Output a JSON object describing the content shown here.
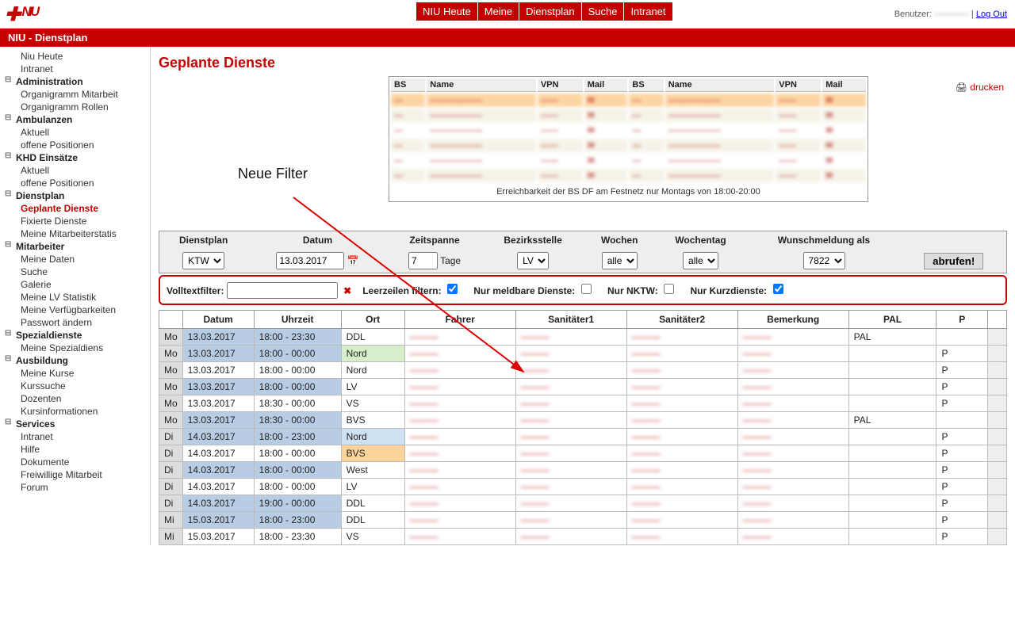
{
  "top": {
    "user_label": "Benutzer:",
    "user_name": "————",
    "logout": "Log Out",
    "nav": [
      "NIU Heute",
      "Meine",
      "Dienstplan",
      "Suche",
      "Intranet"
    ],
    "redbar": "NIU - Dienstplan"
  },
  "sidebar": [
    {
      "type": "leaf",
      "label": "Niu Heute"
    },
    {
      "type": "leaf",
      "label": "Intranet"
    },
    {
      "type": "head",
      "label": "Administration"
    },
    {
      "type": "leaf",
      "label": "Organigramm Mitarbeit"
    },
    {
      "type": "leaf",
      "label": "Organigramm Rollen"
    },
    {
      "type": "head",
      "label": "Ambulanzen"
    },
    {
      "type": "leaf",
      "label": "Aktuell"
    },
    {
      "type": "leaf",
      "label": "offene Positionen"
    },
    {
      "type": "head",
      "label": "KHD Einsätze"
    },
    {
      "type": "leaf",
      "label": "Aktuell"
    },
    {
      "type": "leaf",
      "label": "offene Positionen"
    },
    {
      "type": "head",
      "label": "Dienstplan"
    },
    {
      "type": "leaf",
      "label": "Geplante Dienste",
      "active": true
    },
    {
      "type": "leaf",
      "label": "Fixierte Dienste"
    },
    {
      "type": "leaf",
      "label": "Meine Mitarbeiterstatis"
    },
    {
      "type": "head",
      "label": "Mitarbeiter"
    },
    {
      "type": "leaf",
      "label": "Meine Daten"
    },
    {
      "type": "leaf",
      "label": "Suche"
    },
    {
      "type": "leaf",
      "label": "Galerie"
    },
    {
      "type": "leaf",
      "label": "Meine LV Statistik"
    },
    {
      "type": "leaf",
      "label": "Meine Verfügbarkeiten"
    },
    {
      "type": "leaf",
      "label": "Passwort ändern"
    },
    {
      "type": "head",
      "label": "Spezialdienste"
    },
    {
      "type": "leaf",
      "label": "Meine Spezialdiens"
    },
    {
      "type": "head",
      "label": "Ausbildung"
    },
    {
      "type": "leaf",
      "label": "Meine Kurse"
    },
    {
      "type": "leaf",
      "label": "Kurssuche"
    },
    {
      "type": "leaf",
      "label": "Dozenten"
    },
    {
      "type": "leaf",
      "label": "Kursinformationen"
    },
    {
      "type": "head",
      "label": "Services"
    },
    {
      "type": "leaf",
      "label": "Intranet"
    },
    {
      "type": "leaf",
      "label": "Hilfe"
    },
    {
      "type": "leaf",
      "label": "Dokumente"
    },
    {
      "type": "leaf",
      "label": "Freiwillige Mitarbeit"
    },
    {
      "type": "leaf",
      "label": "Forum"
    }
  ],
  "page": {
    "title": "Geplante Dienste",
    "print": "drucken",
    "annotation": "Neue Filter"
  },
  "topinfo": {
    "headers": [
      "BS",
      "Name",
      "VPN",
      "Mail",
      "BS",
      "Name",
      "VPN",
      "Mail"
    ],
    "footnote": "Erreichbarkeit der BS DF am Festnetz nur Montags von 18:00-20:00"
  },
  "controls": {
    "headers": [
      "Dienstplan",
      "Datum",
      "Zeitspanne",
      "Bezirksstelle",
      "Wochen",
      "Wochentag",
      "Wunschmeldung als",
      ""
    ],
    "dienstplan": "KTW",
    "datum": "13.03.2017",
    "zeitspanne": "7",
    "zeitspanne_unit": "Tage",
    "bezirksstelle": "LV",
    "wochen": "alle",
    "wochentag": "alle",
    "wunsch": "7822",
    "button": "abrufen!"
  },
  "filters": {
    "volltext_label": "Volltextfilter:",
    "volltext_value": "",
    "leer_label": "Leerzeilen filtern:",
    "leer_checked": true,
    "meld_label": "Nur meldbare Dienste:",
    "meld_checked": false,
    "nktw_label": "Nur NKTW:",
    "nktw_checked": false,
    "kurz_label": "Nur Kurzdienste:",
    "kurz_checked": true
  },
  "grid": {
    "headers": [
      "",
      "Datum",
      "Uhrzeit",
      "Ort",
      "Fahrer",
      "Sanitäter1",
      "Sanitäter2",
      "Bemerkung",
      "PAL",
      "P",
      ""
    ],
    "rows": [
      {
        "day": "Mo",
        "date": "13.03.2017",
        "time": "18:00 - 23:30",
        "ort": "DDL",
        "cls": "blue",
        "pal": "PAL",
        "p": ""
      },
      {
        "day": "Mo",
        "date": "13.03.2017",
        "time": "18:00 - 00:00",
        "ort": "Nord",
        "cls": "blue gr",
        "pal": "",
        "p": "P"
      },
      {
        "day": "Mo",
        "date": "13.03.2017",
        "time": "18:00 - 00:00",
        "ort": "Nord",
        "cls": "",
        "pal": "",
        "p": "P"
      },
      {
        "day": "Mo",
        "date": "13.03.2017",
        "time": "18:00 - 00:00",
        "ort": "LV",
        "cls": "blue",
        "pal": "",
        "p": "P"
      },
      {
        "day": "Mo",
        "date": "13.03.2017",
        "time": "18:30 - 00:00",
        "ort": "VS",
        "cls": "",
        "pal": "",
        "p": "P"
      },
      {
        "day": "Mo",
        "date": "13.03.2017",
        "time": "18:30 - 00:00",
        "ort": "BVS",
        "cls": "blue",
        "pal": "PAL",
        "p": ""
      },
      {
        "day": "Di",
        "date": "14.03.2017",
        "time": "18:00 - 23:00",
        "ort": "Nord",
        "cls": "blue lb",
        "pal": "",
        "p": "P"
      },
      {
        "day": "Di",
        "date": "14.03.2017",
        "time": "18:00 - 00:00",
        "ort": "BVS",
        "cls": "or",
        "pal": "",
        "p": "P"
      },
      {
        "day": "Di",
        "date": "14.03.2017",
        "time": "18:00 - 00:00",
        "ort": "West",
        "cls": "blue",
        "pal": "",
        "p": "P"
      },
      {
        "day": "Di",
        "date": "14.03.2017",
        "time": "18:00 - 00:00",
        "ort": "LV",
        "cls": "",
        "pal": "",
        "p": "P"
      },
      {
        "day": "Di",
        "date": "14.03.2017",
        "time": "19:00 - 00:00",
        "ort": "DDL",
        "cls": "blue",
        "pal": "",
        "p": "P"
      },
      {
        "day": "Mi",
        "date": "15.03.2017",
        "time": "18:00 - 23:00",
        "ort": "DDL",
        "cls": "blue",
        "pal": "",
        "p": "P"
      },
      {
        "day": "Mi",
        "date": "15.03.2017",
        "time": "18:00 - 23:30",
        "ort": "VS",
        "cls": "",
        "pal": "",
        "p": "P"
      }
    ]
  }
}
